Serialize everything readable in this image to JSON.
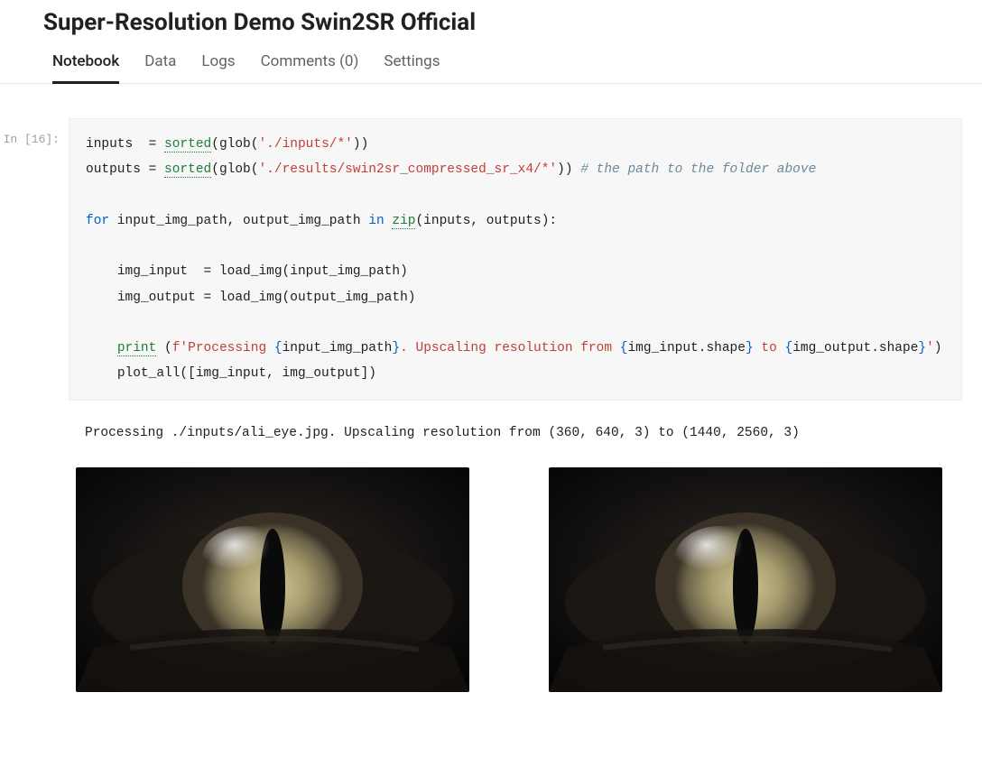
{
  "page_title": "Super-Resolution Demo Swin2SR Official",
  "tabs": {
    "notebook": "Notebook",
    "data": "Data",
    "logs": "Logs",
    "comments": "Comments (0)",
    "settings": "Settings"
  },
  "cell": {
    "prompt": "In [16]:",
    "code": {
      "l1_inputs": "inputs",
      "l1_eq": "  = ",
      "l1_sorted": "sorted",
      "l1_open": "(glob(",
      "l1_str": "'./inputs/*'",
      "l1_close": "))",
      "l2_outputs": "outputs",
      "l2_eq": " = ",
      "l2_sorted": "sorted",
      "l2_open": "(glob(",
      "l2_str": "'./results/swin2sr_compressed_sr_x4/*'",
      "l2_close": ")) ",
      "l2_comment": "# the path to the folder above",
      "l4_for": "for",
      "l4_mid": " input_img_path, output_img_path ",
      "l4_in": "in",
      "l4_sp": " ",
      "l4_zip": "zip",
      "l4_args": "(inputs, outputs):",
      "l6": "    img_input  = load_img(input_img_path)",
      "l7": "    img_output = load_img(output_img_path)",
      "l9_indent": "    ",
      "l9_print": "print",
      "l9_sp": " (",
      "l9_f": "f'Processing ",
      "l9_ob": "{",
      "l9_v1": "input_img_path",
      "l9_cb": "}",
      "l9_mid": ". Upscaling resolution from ",
      "l9_ob2": "{",
      "l9_v2": "img_input.shape",
      "l9_cb2": "}",
      "l9_to": " to ",
      "l9_ob3": "{",
      "l9_v3": "img_output.shape",
      "l9_cb3": "}",
      "l9_end": "'",
      "l9_paren": ")",
      "l10": "    plot_all([img_input, img_output])"
    }
  },
  "output_text": "Processing ./inputs/ali_eye.jpg. Upscaling resolution from (360, 640, 3) to (1440, 2560, 3)"
}
